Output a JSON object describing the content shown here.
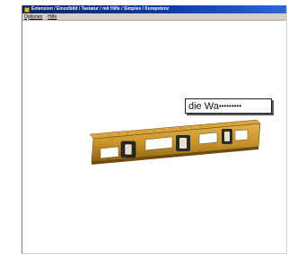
{
  "window": {
    "title": "Extension / Einzelbild / Tastatur / mit Hilfe / Simples / Kompetenz",
    "menu": [
      "Optionen",
      "Hilfe"
    ]
  },
  "exercise": {
    "object_name": "spirit-level",
    "answer_typed": "die Wa",
    "answer_masked": "•••••••••"
  },
  "colors": {
    "titlebar": "#0a246a",
    "level_body": "#c9952a",
    "level_dark": "#8a5f14"
  }
}
